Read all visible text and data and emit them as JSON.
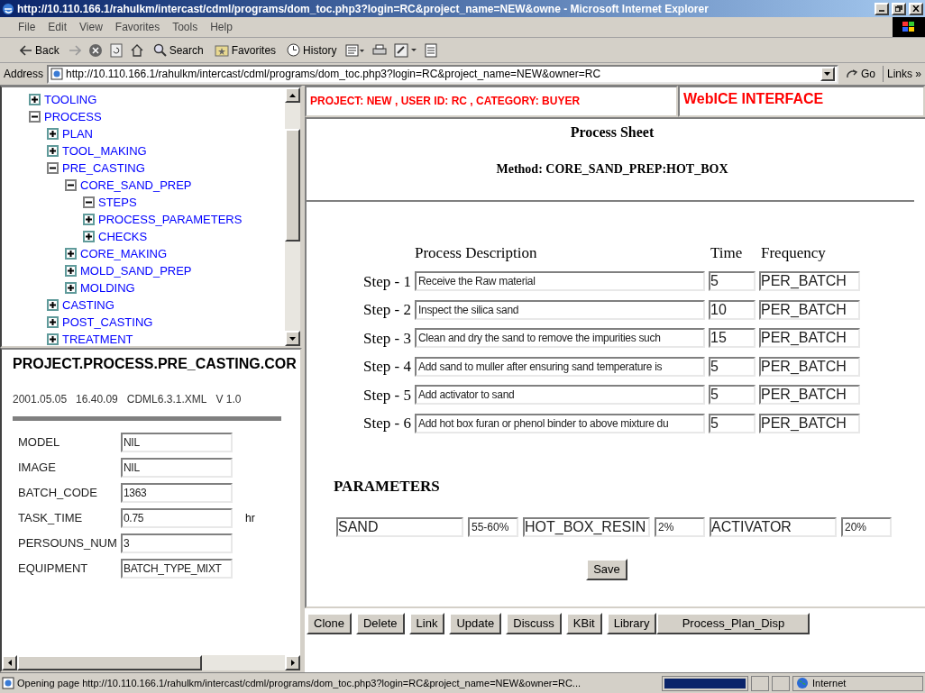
{
  "window": {
    "title": "http://10.110.166.1/rahulkm/intercast/cdml/programs/dom_toc.php3?login=RC&project_name=NEW&owne - Microsoft Internet Explorer"
  },
  "menu": [
    "File",
    "Edit",
    "View",
    "Favorites",
    "Tools",
    "Help"
  ],
  "toolbar": [
    {
      "kind": "back",
      "label": "Back"
    },
    {
      "kind": "forward"
    },
    {
      "kind": "stop"
    },
    {
      "kind": "refresh"
    },
    {
      "kind": "home"
    },
    {
      "kind": "search",
      "label": "Search"
    },
    {
      "kind": "favorites",
      "label": "Favorites"
    },
    {
      "kind": "history",
      "label": "History"
    },
    {
      "kind": "mail"
    },
    {
      "kind": "print"
    },
    {
      "kind": "edit"
    },
    {
      "kind": "discuss"
    }
  ],
  "address_bar": {
    "label": "Address",
    "value": "http://10.110.166.1/rahulkm/intercast/cdml/programs/dom_toc.php3?login=RC&project_name=NEW&owner=RC",
    "go": "Go",
    "links": "Links »"
  },
  "tree": [
    {
      "label": "TOOLING",
      "expanded": false
    },
    {
      "label": "PROCESS",
      "expanded": true,
      "children": [
        {
          "label": "PLAN",
          "expanded": false
        },
        {
          "label": "TOOL_MAKING",
          "expanded": false
        },
        {
          "label": "PRE_CASTING",
          "expanded": true,
          "children": [
            {
              "label": "CORE_SAND_PREP",
              "expanded": true,
              "children": [
                {
                  "label": "STEPS",
                  "expanded": true
                },
                {
                  "label": "PROCESS_PARAMETERS",
                  "expanded": false
                },
                {
                  "label": "CHECKS",
                  "expanded": false
                }
              ]
            },
            {
              "label": "CORE_MAKING",
              "expanded": false
            },
            {
              "label": "MOLD_SAND_PREP",
              "expanded": false
            },
            {
              "label": "MOLDING",
              "expanded": false
            }
          ]
        },
        {
          "label": "CASTING",
          "expanded": false
        },
        {
          "label": "POST_CASTING",
          "expanded": false
        },
        {
          "label": "TREATMENT",
          "expanded": false
        }
      ]
    }
  ],
  "details": {
    "path": "PROJECT.PROCESS.PRE_CASTING.COR",
    "meta": [
      "2001.05.05",
      "16.40.09",
      "CDML6.3.1.XML",
      "V 1.0"
    ],
    "fields": [
      {
        "label": "MODEL",
        "value": "NIL"
      },
      {
        "label": "IMAGE",
        "value": "NIL"
      },
      {
        "label": "BATCH_CODE",
        "value": "1363"
      },
      {
        "label": "TASK_TIME",
        "value": "0.75",
        "unit": "hr"
      },
      {
        "label": "PERSOUNS_NUM",
        "value": "3"
      },
      {
        "label": "EQUIPMENT",
        "value": "BATCH_TYPE_MIXT"
      }
    ]
  },
  "header": {
    "info": "PROJECT: NEW , USER ID: RC , CATEGORY: BUYER",
    "brand": "WebICE INTERFACE"
  },
  "sheet": {
    "title": "Process Sheet",
    "method": "Method: CORE_SAND_PREP:HOT_BOX",
    "columns": [
      "Process Description",
      "Time",
      "Frequency"
    ],
    "steps": [
      {
        "label": "Step - 1",
        "description": "Receive the Raw material",
        "time": "5",
        "frequency": "PER_BATCH"
      },
      {
        "label": "Step - 2",
        "description": "Inspect the silica sand",
        "time": "10",
        "frequency": "PER_BATCH"
      },
      {
        "label": "Step - 3",
        "description": "Clean and dry the sand to remove the impurities such",
        "time": "15",
        "frequency": "PER_BATCH"
      },
      {
        "label": "Step - 4",
        "description": "Add sand to muller after ensuring sand temperature is",
        "time": "5",
        "frequency": "PER_BATCH"
      },
      {
        "label": "Step - 5",
        "description": "Add activator to sand",
        "time": "5",
        "frequency": "PER_BATCH"
      },
      {
        "label": "Step - 6",
        "description": "Add hot box furan or phenol binder to above mixture du",
        "time": "5",
        "frequency": "PER_BATCH"
      }
    ],
    "parameters_title": "PARAMETERS",
    "parameters": [
      {
        "name": "SAND",
        "value": "55-60%"
      },
      {
        "name": "HOT_BOX_RESIN",
        "value": "2%"
      },
      {
        "name": "ACTIVATOR",
        "value": "20%"
      }
    ],
    "save": "Save"
  },
  "actions": [
    "Clone",
    "Delete",
    "Link",
    "Update",
    "Discuss",
    "KBit",
    "Library",
    "Process_Plan_Disp"
  ],
  "status_bar": {
    "text": "Opening page http://10.110.166.1/rahulkm/intercast/cdml/programs/dom_toc.php3?login=RC&project_name=NEW&owner=RC...",
    "level": 1,
    "zone": "Internet"
  }
}
